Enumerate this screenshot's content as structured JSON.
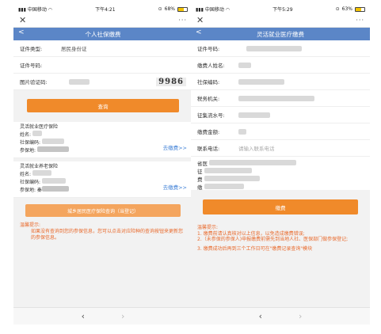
{
  "left": {
    "status": {
      "carrier": "中国移动",
      "time": "下午4:21",
      "battery": "68%",
      "battery_level": 0.68
    },
    "close_glyph": "✕",
    "more_glyph": "···",
    "title": "个人社保缴费",
    "back_glyph": "<",
    "form": {
      "id_type_label": "证件类型:",
      "id_type_value": "居民身份证",
      "id_no_label": "证件号码:",
      "captcha_label": "图片验证码:",
      "captcha_value": "9986"
    },
    "query_button": "查询",
    "medical": {
      "title": "灵活就业医疗保险",
      "name_label": "姓名:",
      "ss_code_label": "社保编码:",
      "place_label": "参保地:",
      "pay_link": "去缴费>>"
    },
    "pension": {
      "title": "灵活就业养老保险",
      "name_label": "姓名:",
      "ss_code_label": "社保编码:",
      "place_label": "参保地: 秦",
      "pay_link": "去缴费>>"
    },
    "resident_query_button": "城乡居民医疗保险查询（当登记）",
    "tip_title": "温馨提示:",
    "tip_body": "如果没有查询到您的参保信息，您可以点击对应险种的查询按钮来更新您的参保信息。",
    "nav_back": "‹",
    "nav_forward": "›"
  },
  "right": {
    "status": {
      "carrier": "中国移动",
      "time": "下午5:29",
      "battery": "63%",
      "battery_level": 0.63
    },
    "close_glyph": "✕",
    "more_glyph": "···",
    "title": "灵活就业医疗缴费",
    "back_glyph": "<",
    "rows": {
      "id_no": "证件号码:",
      "payer_name": "缴费人姓名:",
      "ss_code": "社保编码:",
      "tax_office": "税务机关:",
      "serial_no": "征集流水号:",
      "amount": "缴费金额:",
      "phone_label": "联系电话:",
      "phone_placeholder": "请输入联系电话"
    },
    "range": {
      "line1": "省医",
      "line2": "征",
      "line3": "费",
      "line4": "缴"
    },
    "pay_button": "缴费",
    "notes": {
      "title": "温馨提示:",
      "n1": "1. 缴费前请认真核对以上信息，以免造成缴费错误;",
      "n2": "2.（未参保的参保人)申报缴费前需先到当地人社、医保部门做参保登记;",
      "n3": "3. 缴费成功后再到三个工作日可在\"缴费记录查询\"模块"
    },
    "nav_back": "‹",
    "nav_forward": "›"
  }
}
